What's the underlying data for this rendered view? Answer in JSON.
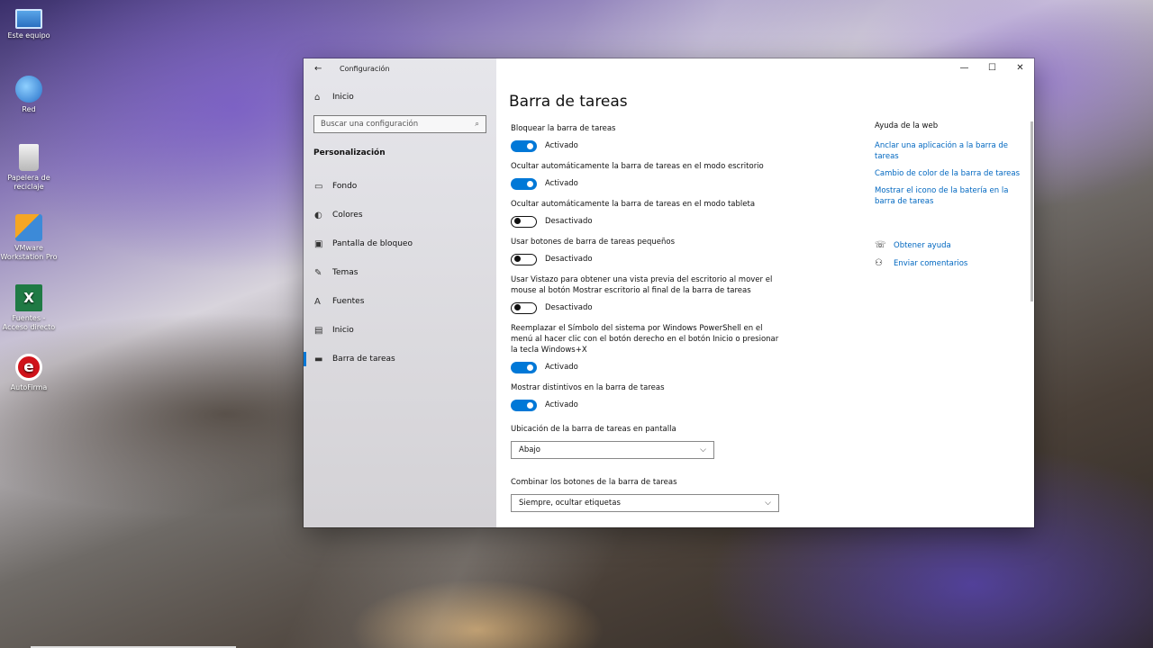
{
  "desktop": {
    "icons": [
      {
        "label": "Este equipo"
      },
      {
        "label": "Red"
      },
      {
        "label": "Papelera de reciclaje"
      },
      {
        "label": "VMware Workstation Pro"
      },
      {
        "label": "Fuentes - Acceso directo"
      },
      {
        "label": "AutoFirma"
      }
    ]
  },
  "window": {
    "app_title": "Configuración",
    "sidebar": {
      "home": "Inicio",
      "search_placeholder": "Buscar una configuración",
      "section": "Personalización",
      "items": [
        {
          "label": "Fondo"
        },
        {
          "label": "Colores"
        },
        {
          "label": "Pantalla de bloqueo"
        },
        {
          "label": "Temas"
        },
        {
          "label": "Fuentes"
        },
        {
          "label": "Inicio"
        },
        {
          "label": "Barra de tareas"
        }
      ]
    },
    "page_title": "Barra de tareas",
    "settings": [
      {
        "label": "Bloquear la barra de tareas",
        "state": "Activado"
      },
      {
        "label": "Ocultar automáticamente la barra de tareas en el modo escritorio",
        "state": "Activado"
      },
      {
        "label": "Ocultar automáticamente la barra de tareas en el modo tableta",
        "state": "Desactivado"
      },
      {
        "label": "Usar botones de barra de tareas pequeños",
        "state": "Desactivado"
      },
      {
        "label": "Usar Vistazo para obtener una vista previa del escritorio al mover el mouse al botón Mostrar escritorio al final de la barra de tareas",
        "state": "Desactivado"
      },
      {
        "label": "Reemplazar el Símbolo del sistema por Windows PowerShell en el menú al hacer clic con el botón derecho en el botón Inicio o presionar la tecla Windows+X",
        "state": "Activado"
      },
      {
        "label": "Mostrar distintivos en la barra de tareas",
        "state": "Activado"
      }
    ],
    "location": {
      "label": "Ubicación de la barra de tareas en pantalla",
      "value": "Abajo"
    },
    "combine": {
      "label": "Combinar los botones de la barra de tareas",
      "value": "Siempre, ocultar etiquetas"
    },
    "help": {
      "title": "Ayuda de la web",
      "links": [
        {
          "label": "Anclar una aplicación a la barra de tareas"
        },
        {
          "label": "Cambio de color de la barra de tareas"
        },
        {
          "label": "Mostrar el icono de la batería en la barra de tareas"
        }
      ],
      "get_help": "Obtener ayuda",
      "feedback": "Enviar comentarios"
    },
    "controls": {
      "minimize": "—",
      "maximize": "☐",
      "close": "✕"
    }
  }
}
